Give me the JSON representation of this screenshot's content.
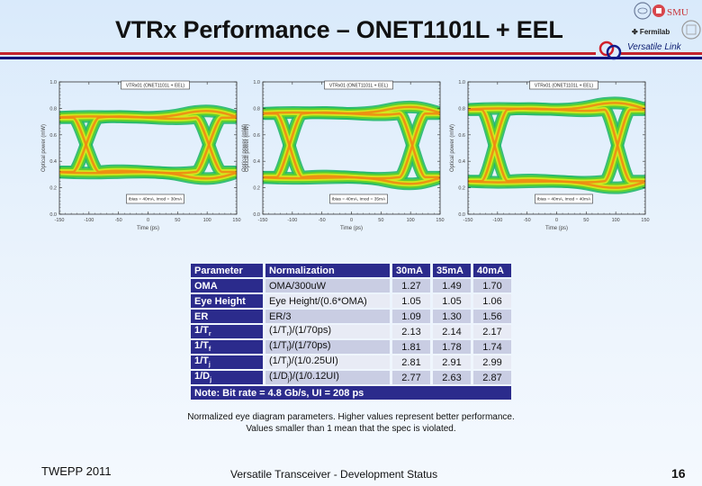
{
  "slide": {
    "title": "VTRx Performance – ONET1101L + EEL",
    "brand_text": "Versatile Link",
    "logos": [
      "CERN",
      "SMU",
      "Fermilab",
      "Oxford"
    ],
    "colors": {
      "accent_red": "#c4242c",
      "accent_navy": "#14147a",
      "table_header": "#2b2b8c"
    }
  },
  "plots": [
    {
      "title": "VTRx01 (ONET1101L + EEL)",
      "annotation": "Ibias = 40mA, Imod = 30mA",
      "xlabel": "Time (ps)",
      "ylabel": "Optical power (mW)",
      "xticks": [
        "-150",
        "-100",
        "-50",
        "0",
        "50",
        "100",
        "150"
      ],
      "yticks": [
        "0.0",
        "0.2",
        "0.4",
        "0.6",
        "0.8",
        "1.0"
      ],
      "xlim": [
        -150,
        150
      ],
      "ylim": [
        0,
        1
      ],
      "level_high": 0.73,
      "level_low": 0.32,
      "crossing_x": [
        -105,
        103
      ]
    },
    {
      "title": "VTRx01 (ONET1101L + EEL)",
      "annotation": "Ibias = 40mA, Imod = 35mA",
      "xlabel": "Time (ps)",
      "ylabel": "Optical power (mW)",
      "xticks": [
        "-150",
        "-100",
        "-50",
        "0",
        "50",
        "100",
        "150"
      ],
      "yticks": [
        "0.0",
        "0.2",
        "0.4",
        "0.6",
        "0.8",
        "1.0"
      ],
      "xlim": [
        -150,
        150
      ],
      "ylim": [
        0,
        1
      ],
      "level_high": 0.76,
      "level_low": 0.28,
      "crossing_x": [
        -105,
        103
      ]
    },
    {
      "title": "VTRx01 (ONET1101L + EEL)",
      "annotation": "Ibias = 40mA, Imod = 40mA",
      "xlabel": "Time (ps)",
      "ylabel": "Optical power (mW)",
      "xticks": [
        "-150",
        "-100",
        "-50",
        "0",
        "50",
        "100",
        "150"
      ],
      "yticks": [
        "0.0",
        "0.2",
        "0.4",
        "0.6",
        "0.8",
        "1.0"
      ],
      "xlim": [
        -150,
        150
      ],
      "ylim": [
        0,
        1
      ],
      "level_high": 0.79,
      "level_low": 0.25,
      "crossing_x": [
        -105,
        103
      ]
    }
  ],
  "table": {
    "headers": [
      "Parameter",
      "Normalization",
      "30mA",
      "35mA",
      "40mA"
    ],
    "rows": [
      {
        "param": "OMA",
        "param_sub": "",
        "norm": "OMA/300uW",
        "values": [
          "1.27",
          "1.49",
          "1.70"
        ]
      },
      {
        "param": "Eye Height",
        "param_sub": "",
        "norm": "Eye Height/(0.6*OMA)",
        "values": [
          "1.05",
          "1.05",
          "1.06"
        ]
      },
      {
        "param": "ER",
        "param_sub": "",
        "norm": "ER/3",
        "values": [
          "1.09",
          "1.30",
          "1.56"
        ]
      },
      {
        "param": "1/T",
        "param_sub": "r",
        "norm_a": "(1/T",
        "norm_sub": "r",
        "norm_b": ")/(1/70ps)",
        "values": [
          "2.13",
          "2.14",
          "2.17"
        ]
      },
      {
        "param": "1/T",
        "param_sub": "f",
        "norm_a": "(1/T",
        "norm_sub": "f",
        "norm_b": ")/(1/70ps)",
        "values": [
          "1.81",
          "1.78",
          "1.74"
        ]
      },
      {
        "param": "1/T",
        "param_sub": "j",
        "norm_a": "(1/T",
        "norm_sub": "j",
        "norm_b": ")/(1/0.25UI)",
        "values": [
          "2.81",
          "2.91",
          "2.99"
        ]
      },
      {
        "param": "1/D",
        "param_sub": "j",
        "norm_a": "(1/D",
        "norm_sub": "j",
        "norm_b": ")/(1/0.12UI)",
        "values": [
          "2.77",
          "2.63",
          "2.87"
        ]
      }
    ],
    "note": "Note: Bit rate = 4.8 Gb/s, UI = 208 ps"
  },
  "caption": "Normalized eye diagram parameters. Higher values represent better performance. Values smaller than 1 mean that the spec is violated.",
  "footer": {
    "left": "TWEPP 2011",
    "center": "Versatile Transceiver - Development Status",
    "page": "16"
  }
}
